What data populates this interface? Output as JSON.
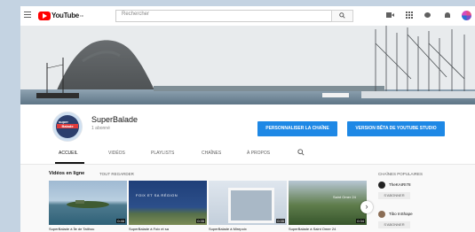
{
  "topbar": {
    "logo_text": "YouTube",
    "logo_sup": "FR",
    "search_placeholder": "Rechercher",
    "icons": [
      "menu-icon",
      "search-icon",
      "video-upload-icon",
      "apps-icon",
      "messages-icon",
      "notifications-icon"
    ]
  },
  "channel": {
    "name": "SuperBalade",
    "subscribers": "1 abonné",
    "avatar_text_top": "super",
    "avatar_text_bottom": "Balade",
    "customize_button": "PERSONNALISER LA CHAÎNE",
    "studio_button": "VERSION BÊTA DE YOUTUBE STUDIO"
  },
  "tabs": [
    "ACCUEIL",
    "VIDÉOS",
    "PLAYLISTS",
    "CHAÎNES",
    "À PROPOS"
  ],
  "active_tab": "ACCUEIL",
  "uploads": {
    "title": "Vidéos en ligne",
    "link": "TOUT REGARDER",
    "videos": [
      {
        "title": "SuperBalade à Île de Tatihou",
        "duration": "0:46",
        "thumb_text": ""
      },
      {
        "title": "SuperBalade à Foix et sa",
        "duration": "0:35",
        "thumb_text": "FOIX ET SA RÉGION"
      },
      {
        "title": "SuperBalade à Mirepoix",
        "duration": "0:35",
        "thumb_text": ""
      },
      {
        "title": "SuperBalade à Saint Omer 24",
        "duration": "0:34",
        "thumb_text": "Saint Omer 24"
      }
    ]
  },
  "featured": {
    "title": "CHAÎNES POPULAIRES",
    "channels": [
      {
        "name": "TheKAIRI78",
        "button": "S'ABONNER"
      },
      {
        "name": "Tibo InShape",
        "button": "S'ABONNER"
      }
    ]
  },
  "colors": {
    "brand_red": "#ff0000",
    "accent_blue": "#1e88e5"
  }
}
